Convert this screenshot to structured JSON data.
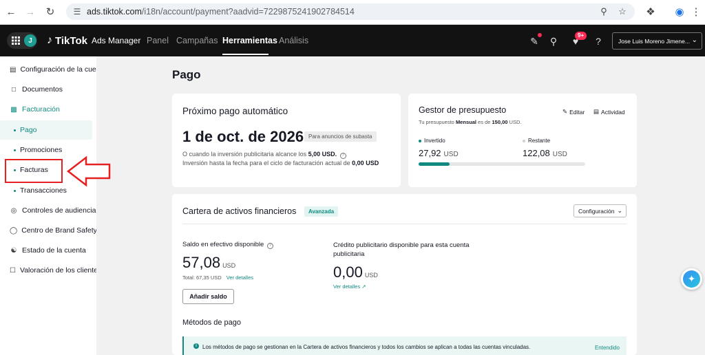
{
  "browser": {
    "url_host": "ads.tiktok.com",
    "url_path": "/i18n/account/payment?aadvid=7229875241902784514"
  },
  "header": {
    "avatar_letter": "J",
    "logo_brand": "TikTok",
    "logo_product": "Ads Manager",
    "nav": [
      {
        "label": "Panel"
      },
      {
        "label": "Campañas"
      },
      {
        "label": "Herramientas"
      },
      {
        "label": "Análisis"
      }
    ],
    "notification_count": "9+",
    "account_name": "Jose Luis Moreno Jimene..."
  },
  "sidebar": {
    "items": [
      {
        "label": "Configuración de la cuenta"
      },
      {
        "label": "Documentos"
      },
      {
        "label": "Facturación"
      },
      {
        "label": "Pago"
      },
      {
        "label": "Promociones"
      },
      {
        "label": "Facturas"
      },
      {
        "label": "Transacciones"
      },
      {
        "label": "Controles de audiencia"
      },
      {
        "label": "Centro de Brand Safety"
      },
      {
        "label": "Estado de la cuenta"
      },
      {
        "label": "Valoración de los clientes"
      }
    ]
  },
  "page": {
    "title": "Pago"
  },
  "next_payment": {
    "title": "Próximo pago automático",
    "date": "1 de oct. de 2026",
    "tag": "Para anuncios de subasta",
    "threshold_prefix": "O cuando la inversión publicitaria alcance los",
    "threshold_value": "5,00 USD.",
    "spend_prefix": "Inversión hasta la fecha para el ciclo de facturación actual de",
    "spend_value": "0,00 USD"
  },
  "budget": {
    "title": "Gestor de presupuesto",
    "edit_label": "Editar",
    "activity_label": "Actividad",
    "desc_prefix": "Tu presupuesto",
    "desc_period": "Mensual",
    "desc_mid": "es de",
    "desc_value": "150,00",
    "desc_suffix": "USD.",
    "invested_label": "Invertido",
    "invested_value": "27,92",
    "remaining_label": "Restante",
    "remaining_value": "122,08",
    "currency": "USD",
    "progress_fraction": 0.186
  },
  "wallet": {
    "title": "Cartera de activos financieros",
    "tag": "Avanzada",
    "config_label": "Configuración",
    "cash_label": "Saldo en efectivo disponible",
    "cash_value": "57,08",
    "cash_currency": "USD",
    "total_text": "Total: 67,35 USD",
    "details_link": "Ver detalles",
    "credit_label": "Crédito publicitario disponible para esta cuenta publicitaria",
    "credit_value": "0,00",
    "credit_currency": "USD",
    "credit_details_link": "Ver detalles",
    "add_balance_button": "Añadir saldo"
  },
  "payment_methods": {
    "title": "Métodos de pago",
    "info_text": "Los métodos de pago se gestionan en la Cartera de activos financieros y todos los cambios se aplican a todas las cuentas vinculadas.",
    "info_link": "Entendido"
  },
  "colors": {
    "accent": "#108a80",
    "header_bg": "#121212",
    "highlight": "#e62020"
  }
}
